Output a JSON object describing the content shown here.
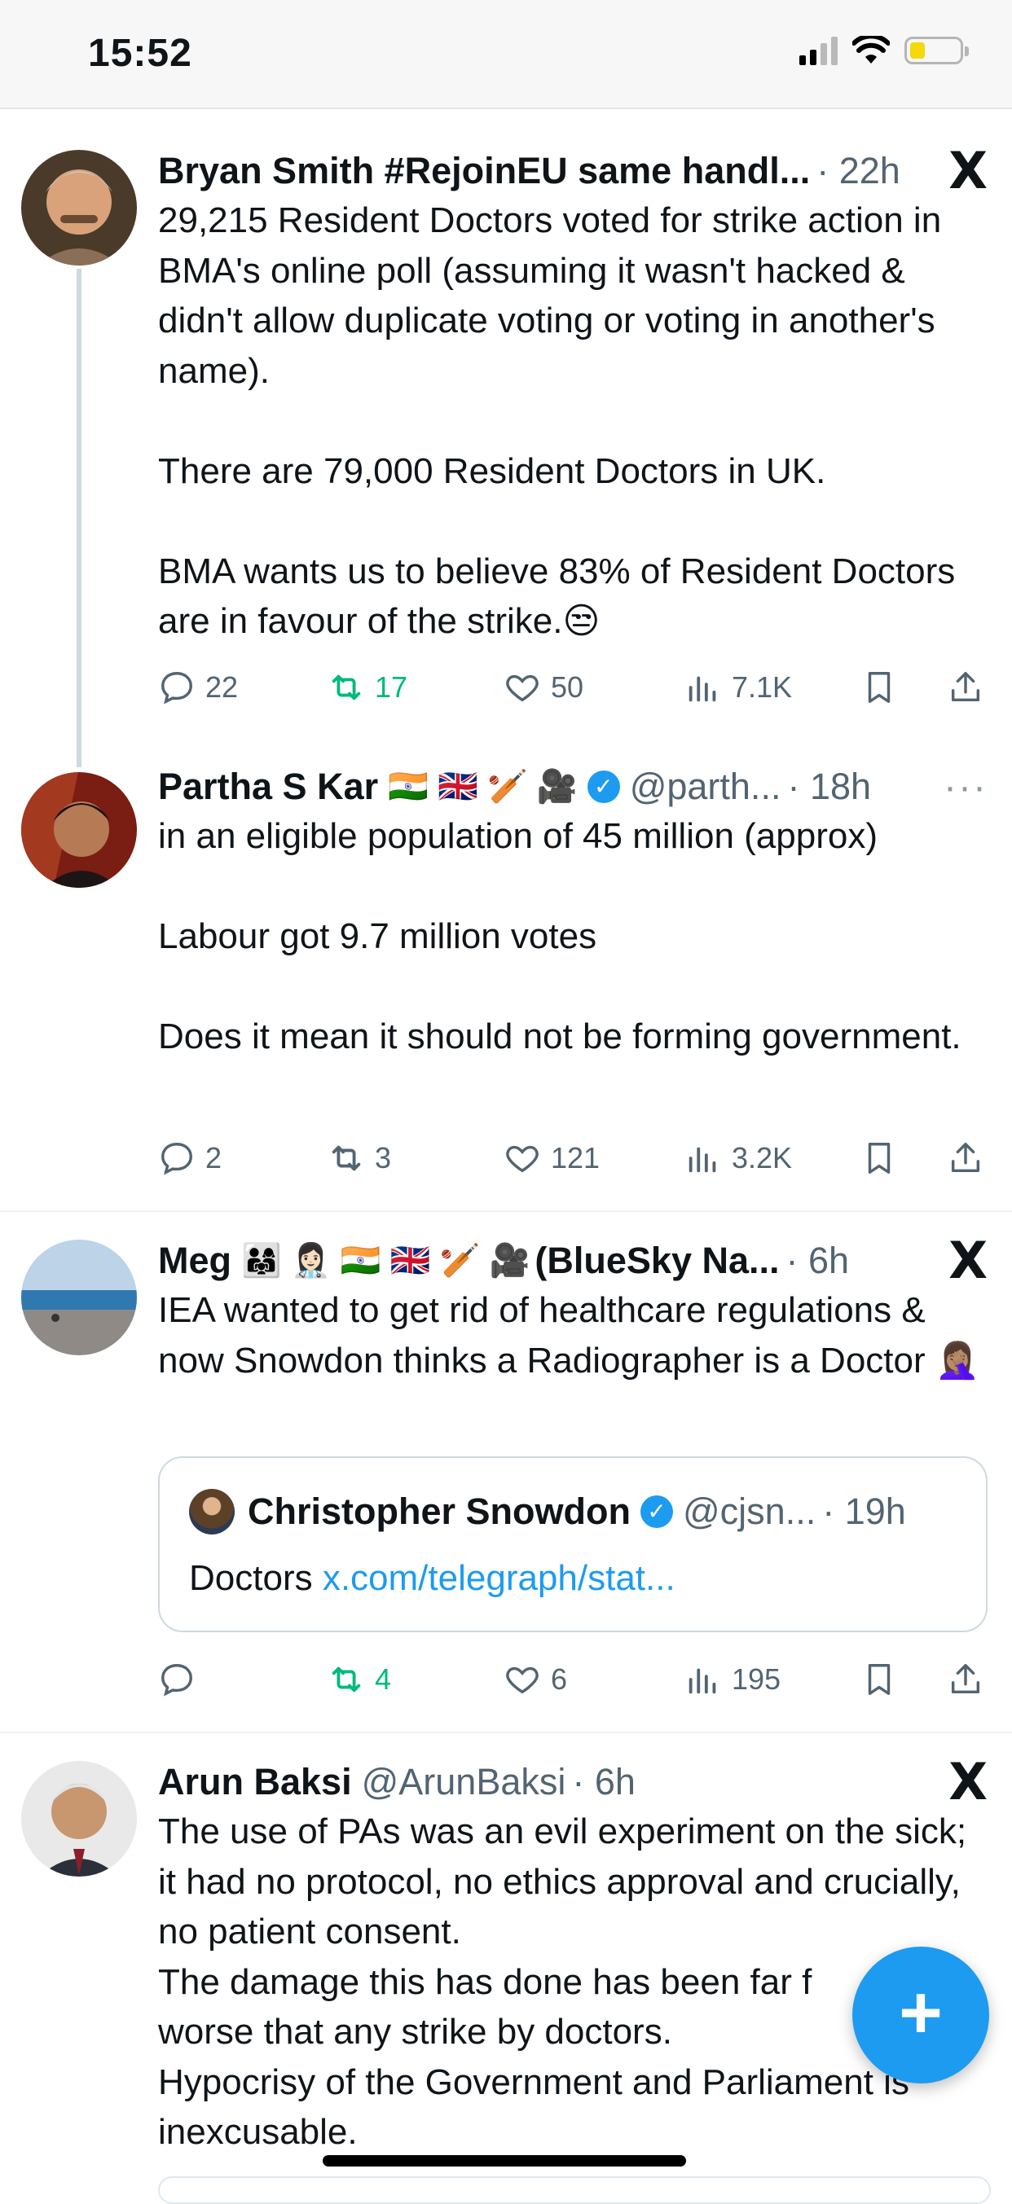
{
  "status_bar": {
    "time": "15:52"
  },
  "tweets": [
    {
      "name": "Bryan Smith #RejoinEU same handl...",
      "flags": "",
      "handle": "",
      "meta": "· 22h",
      "corner": "X",
      "text": "29,215 Resident Doctors voted for strike action in BMA's online poll (assuming it wasn't hacked & didn't allow duplicate voting or voting in another's name).\n\nThere are 79,000 Resident Doctors in UK.\n\nBMA wants us to believe 83% of Resident Doctors are in favour of the strike.😒",
      "actions": {
        "replies": "22",
        "reposts": "17",
        "likes": "50",
        "views": "7.1K"
      }
    },
    {
      "name": "Partha S Kar",
      "flags": "🇮🇳 🇬🇧 🏏 🎥",
      "handle": "@parth...",
      "meta": "· 18h",
      "corner": "···",
      "text": "in an eligible population of 45 million (approx)\n\nLabour got 9.7 million votes\n\nDoes it mean it should not be forming government.",
      "actions": {
        "replies": "2",
        "reposts": "3",
        "likes": "121",
        "views": "3.2K"
      }
    },
    {
      "name": "Meg",
      "flags": "👨‍👩‍👧 👩🏻‍⚕️ 🇮🇳 🇬🇧 🏏 🎥",
      "name_suffix": "(BlueSky Na...",
      "handle": "",
      "meta": "· 6h",
      "corner": "X",
      "text": "IEA wanted to get rid of healthcare regulations & now Snowdon thinks a Radiographer is a Doctor 🤦🏽‍♀️",
      "quote": {
        "name": "Christopher Snowdon",
        "handle": "@cjsn...",
        "meta": "· 19h",
        "text": "Doctors ",
        "link": "x.com/telegraph/stat..."
      },
      "actions": {
        "replies": "",
        "reposts": "4",
        "likes": "6",
        "views": "195"
      }
    },
    {
      "name": "Arun Baksi",
      "flags": "",
      "handle": "@ArunBaksi",
      "meta": "· 6h",
      "corner": "X",
      "text": "The use of PAs was an evil experiment on the sick; it had no protocol, no ethics approval and crucially, no patient consent.\nThe damage this has done has been far f\nworse that any strike by doctors.\nHypocrisy of the Government and Parliament is inexcusable."
    }
  ],
  "fab": {
    "label": "+"
  },
  "colors": {
    "accent": "#1d9bf0",
    "repost_active": "#00ba7c",
    "secondary_text": "#536471"
  }
}
